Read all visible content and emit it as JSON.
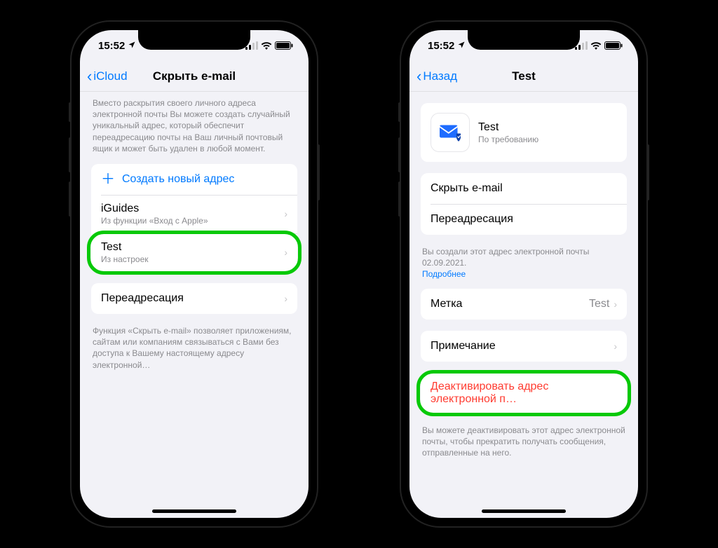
{
  "status": {
    "time": "15:52",
    "location_icon": "location-arrow-icon"
  },
  "left": {
    "back_label": "iCloud",
    "title": "Скрыть e-mail",
    "intro": "Вместо раскрытия своего личного адреса электронной почты Вы можете создать случайный уникальный адрес, который обеспечит переадресацию почты на Ваш личный почтовый ящик и может быть удален в любой момент.",
    "create_label": "Создать новый адрес",
    "items": [
      {
        "title": "iGuides",
        "sub": "Из функции «Вход с Apple»"
      },
      {
        "title": "Test",
        "sub": "Из настроек"
      }
    ],
    "forwarding_label": "Переадресация",
    "footer": "Функция «Скрыть e-mail» позволяет приложениям, сайтам или компаниям связываться с Вами без доступа к Вашему настоящему адресу электронной…"
  },
  "right": {
    "back_label": "Назад",
    "title": "Test",
    "card": {
      "title": "Test",
      "sub": "По требованию"
    },
    "hide_label": "Скрыть e-mail",
    "forwarding_label": "Переадресация",
    "created_text": "Вы создали этот адрес электронной почты 02.09.2021.",
    "learn_more": "Подробнее",
    "label_row": {
      "title": "Метка",
      "value": "Test"
    },
    "note_label": "Примечание",
    "deactivate_label": "Деактивировать адрес электронной п…",
    "deactivate_footer": "Вы можете деактивировать этот адрес электронной почты, чтобы прекратить получать сообщения, отправленные на него."
  }
}
